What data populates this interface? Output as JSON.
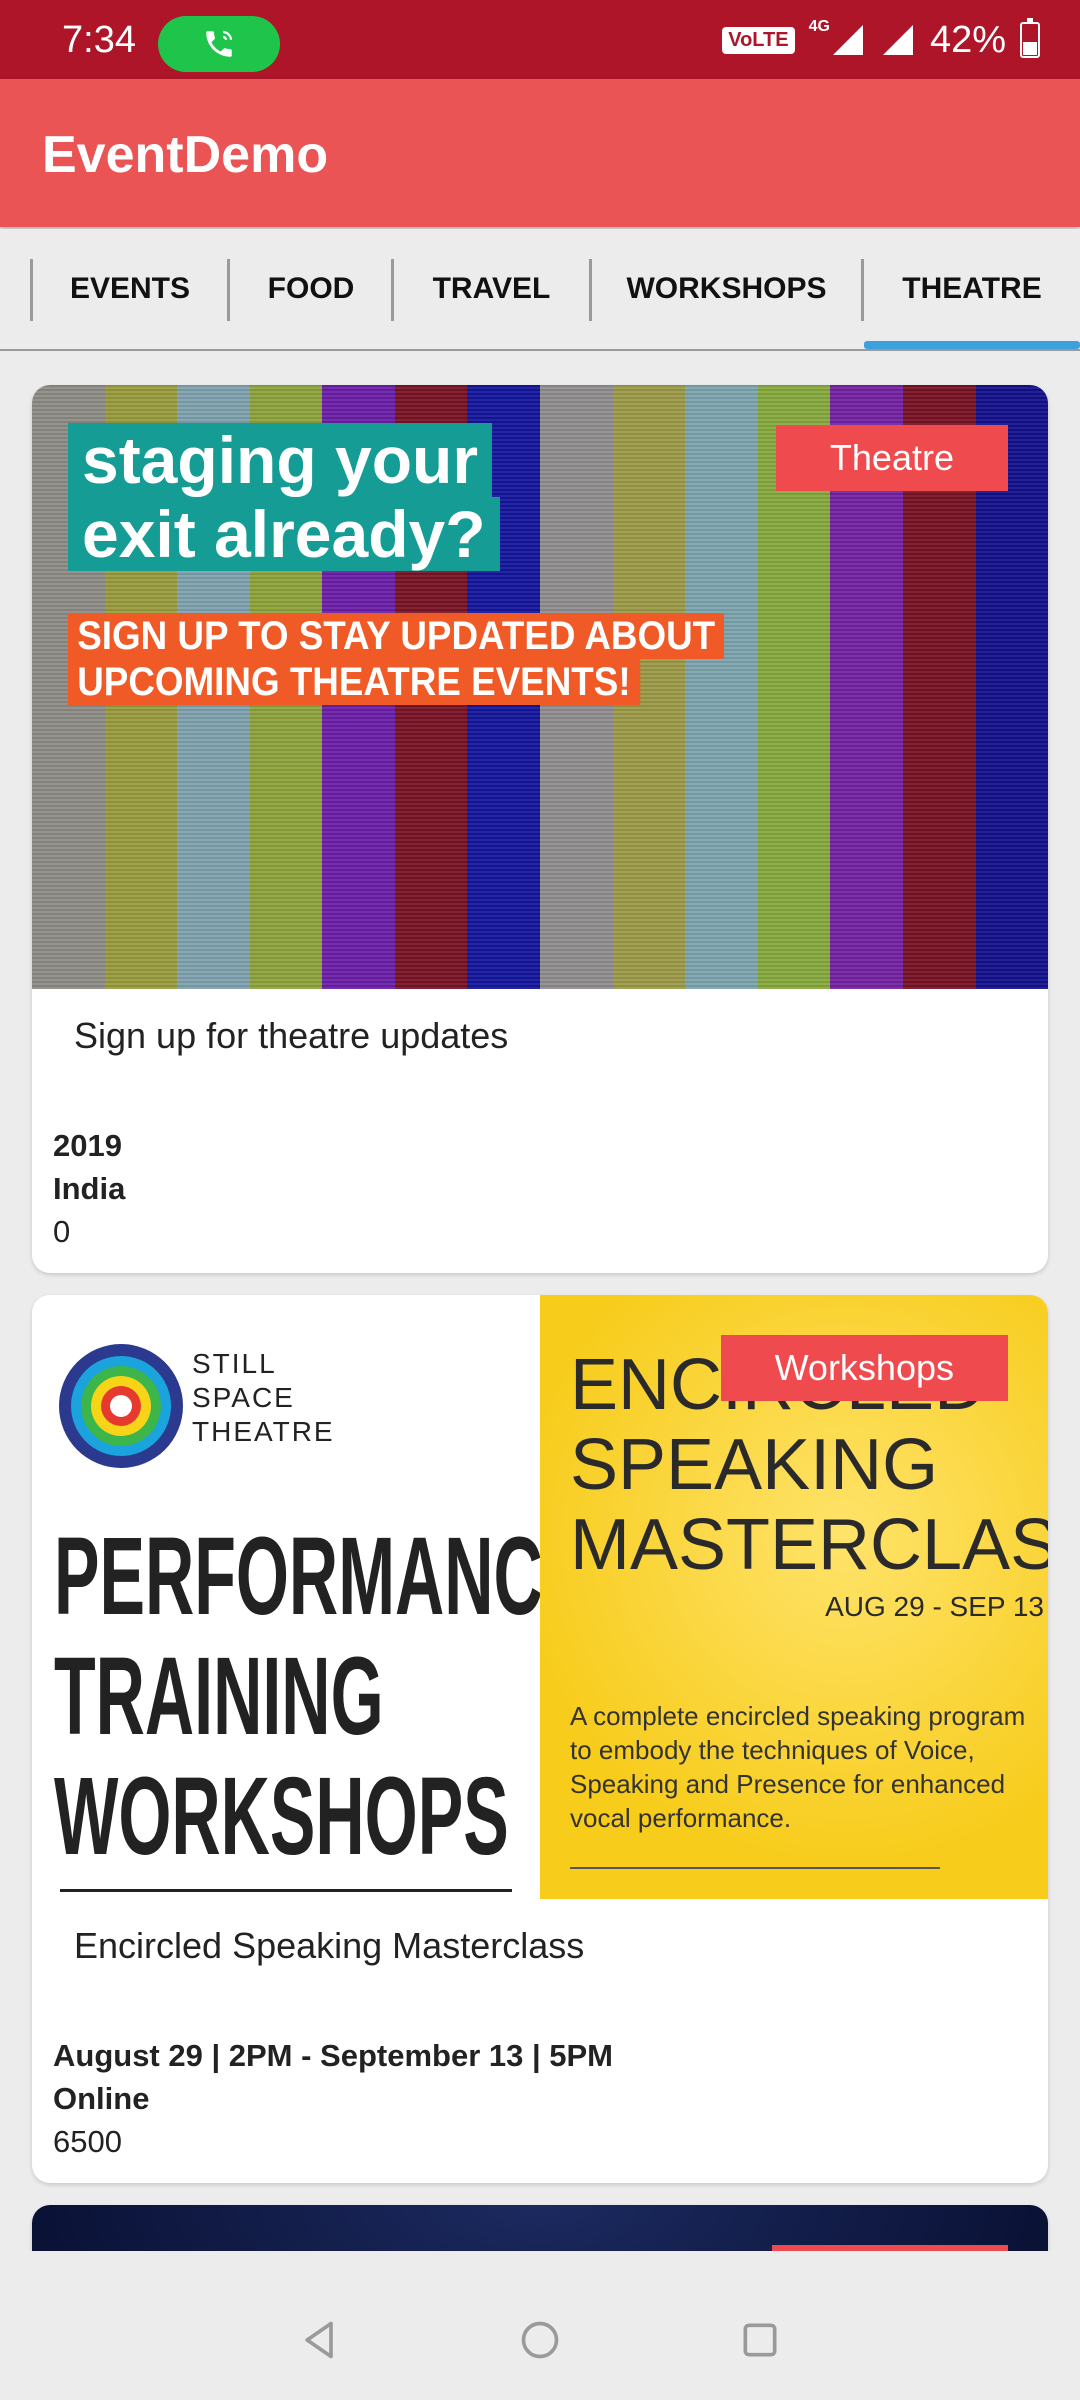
{
  "status_bar": {
    "time": "7:34",
    "network_badge": "VoLTE",
    "network_type": "4G",
    "battery": "42%",
    "icons": [
      "call-icon",
      "volte-icon",
      "signal-icon",
      "battery-icon"
    ]
  },
  "app_bar": {
    "title": "EventDemo"
  },
  "tabs": [
    {
      "label": "EVENTS"
    },
    {
      "label": "FOOD"
    },
    {
      "label": "TRAVEL"
    },
    {
      "label": "WORKSHOPS"
    },
    {
      "label": "THEATRE",
      "selected": true
    }
  ],
  "cards": [
    {
      "badge": "Theatre",
      "image_text": {
        "headline_line1": "staging your",
        "headline_line2": "exit already?",
        "sub_line1": "SIGN UP TO STAY UPDATED ABOUT",
        "sub_line2": "UPCOMING THEATRE EVENTS!"
      },
      "title": "Sign up for theatre updates",
      "date": "2019",
      "location": "India",
      "price": "0"
    },
    {
      "badge": "Workshops",
      "image_text": {
        "org_line1": "STILL",
        "org_line2": "SPACE",
        "org_line3": "THEATRE",
        "left_headline": "PERFORMANCE TRAINING WORKSHOPS",
        "right_title": "ENCIRCLED SPEAKING MASTERCLASS",
        "right_dates": "AUG 29 - SEP 13",
        "right_desc": "A complete encircled speaking program to embody the techniques of Voice, Speaking and Presence for enhanced vocal performance."
      },
      "title": "Encircled Speaking Masterclass",
      "date": "August 29 | 2PM - September 13 | 5PM",
      "location": "Online",
      "price": "6500"
    }
  ],
  "colors": {
    "status_bar": "#ae1528",
    "app_bar": "#ea5455",
    "badge": "#ef4b4e",
    "tab_indicator": "#3aa0de",
    "call_pill": "#1fc54a"
  },
  "nav": {
    "icons": [
      "back-icon",
      "home-icon",
      "recents-icon"
    ]
  }
}
